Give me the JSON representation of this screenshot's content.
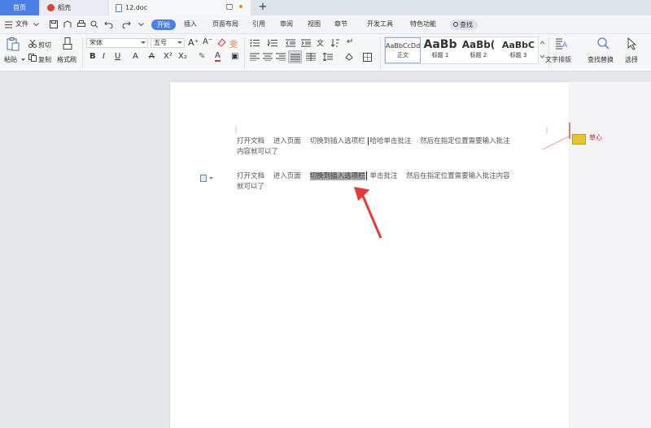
{
  "tabs": {
    "home": "首页",
    "daoke": "稻壳",
    "doc": "12.doc",
    "add": "+"
  },
  "menu": {
    "file": "文件",
    "items": [
      "插入",
      "页面布局",
      "引用",
      "审阅",
      "视图",
      "章节",
      "开发工具",
      "特色功能"
    ],
    "active": "开始",
    "search": "查找"
  },
  "ribbon": {
    "paste": "粘贴",
    "cut": "剪切",
    "copy": "复制",
    "format_painter": "格式刷",
    "font_name": "宋体",
    "font_size": "五号",
    "styles": [
      {
        "sample": "AaBbCcDd",
        "name": "正文"
      },
      {
        "sample": "AaBb",
        "name": "标题 1"
      },
      {
        "sample": "AaBb(",
        "name": "标题 2"
      },
      {
        "sample": "AaBbC",
        "name": "标题 3"
      }
    ],
    "text_layout": "文字排版",
    "find_replace": "查找替换",
    "select": "选择"
  },
  "document": {
    "para1_line1_a": "打开文档    进入页面    切换到插入选项栏 ",
    "para1_line1_b": "哈哈单击批注    然后在指定位置需要输入批注",
    "para1_line2": "内容就可以了",
    "para2_line1_a": "打开文档    进入页面    ",
    "para2_selected": "切换到插入选项栏",
    "para2_line1_b": " 单击批注    然后在指定位置需要输入批注内容",
    "para2_line2": "就可以了"
  },
  "comment": {
    "author": "草心"
  },
  "colors": {
    "accent": "#4a7fe6",
    "arrow": "#e53a3a",
    "comment_author": "#b4232b"
  }
}
